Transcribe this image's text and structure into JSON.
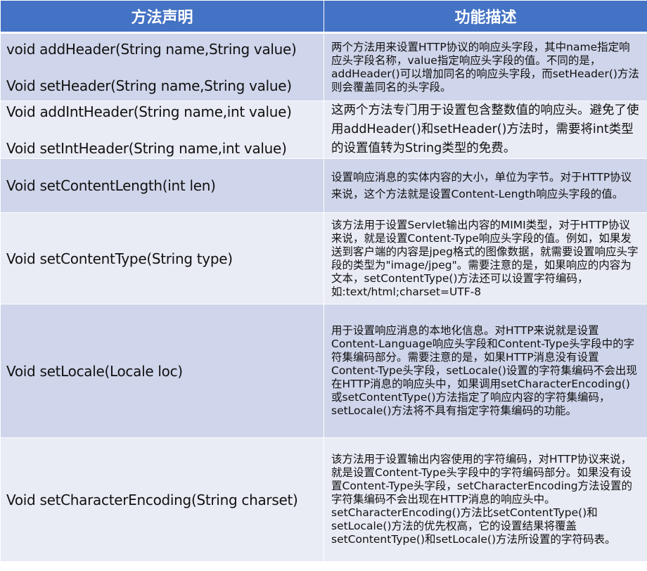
{
  "table": {
    "headers": [
      "方法声明",
      "功能描述"
    ],
    "rows": [
      {
        "methods": [
          "void addHeader(String name,String value)",
          "Void setHeader(String name,String value)"
        ],
        "description": "两个方法用来设置HTTP协议的响应头字段，其中name指定响应头字段名称，value指定响应头字段的值。不同的是，addHeader()可以增加同名的响应头字段，而setHeader()方法则会覆盖同名的头字段。"
      },
      {
        "methods": [
          "Void addIntHeader(String name,int value)",
          "Void setIntHeader(String name,int value)"
        ],
        "description": "这两个方法专门用于设置包含整数值的响应头。避免了使用addHeader()和setHeader()方法时，需要将int类型的设置值转为String类型的免费。"
      },
      {
        "methods": [
          "Void setContentLength(int len)"
        ],
        "description": "设置响应消息的实体内容的大小，单位为字节。对于HTTP协议来说，这个方法就是设置Content-Length响应头字段的值。"
      },
      {
        "methods": [
          "Void setContentType(String type)"
        ],
        "description": "该方法用于设置Servlet输出内容的MIMI类型，对于HTTP协议来说，就是设置Content-Type响应头字段的值。例如，如果发送到客户端的内容是jpeg格式的图像数据，就需要设置响应头字段的类型为\"image/jpeg\"。需要注意的是，如果响应的内容为文本，setContentType()方法还可以设置字符编码，如:text/html;charset=UTF-8"
      },
      {
        "methods": [
          "Void setLocale(Locale loc)"
        ],
        "description": "用于设置响应消息的本地化信息。对HTTP来说就是设置Content-Language响应头字段和Content-Type头字段中的字符集编码部分。需要注意的是，如果HTTP消息没有设置Content-Type头字段，setLocale()设置的字符集编码不会出现在HTTP消息的响应头中，如果调用setCharacterEncoding()或setContentType()方法指定了响应内容的字符集编码，setLocale()方法将不具有指定字符集编码的功能。"
      },
      {
        "methods": [
          "Void setCharacterEncoding(String charset)"
        ],
        "description": "该方法用于设置输出内容使用的字符编码，对HTTP协议来说，就是设置Content-Type头字段中的字符编码部分。如果没有设置Content-Type头字段，setCharacterEncoding方法设置的字符集编码不会出现在HTTP消息的响应头中。setCharacterEncoding()方法比setContentType()和setLocale()方法的优先权高，它的设置结果将覆盖setContentType()和setLocale()方法所设置的字符码表。"
      }
    ]
  }
}
